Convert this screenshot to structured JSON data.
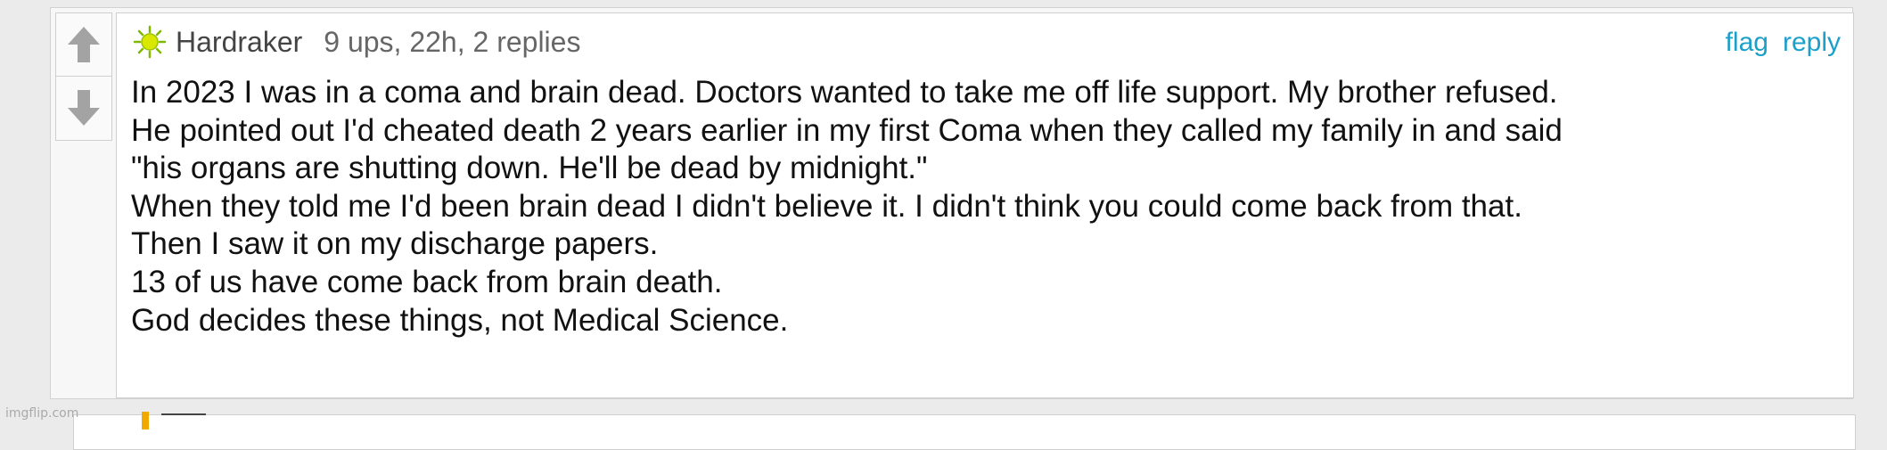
{
  "comment": {
    "username": "Hardraker",
    "meta": "9 ups, 22h, 2 replies",
    "actions": {
      "flag": "flag",
      "reply": "reply"
    },
    "icons": {
      "avatar": "sun-avatar-icon",
      "upvote": "arrow-up-icon",
      "downvote": "arrow-down-icon"
    },
    "body_lines": [
      "In 2023 I was in a coma and brain dead. Doctors wanted to take me off life support. My brother refused.",
      "He pointed out I'd cheated death 2 years earlier in my first Coma when they called my family in and said",
      "\"his organs are shutting down. He'll be dead by midnight.\"",
      "When they told me I'd been brain dead I didn't believe it. I didn't think you could come back from that.",
      "Then I saw it on my discharge papers.",
      "13 of us have come back from brain death.",
      "God decides these things, not Medical Science."
    ]
  },
  "watermark": "imgflip.com",
  "colors": {
    "link": "#1ca0c9",
    "vote_arrow": "#a3a3a3",
    "avatar_sun": "#d8e800"
  }
}
